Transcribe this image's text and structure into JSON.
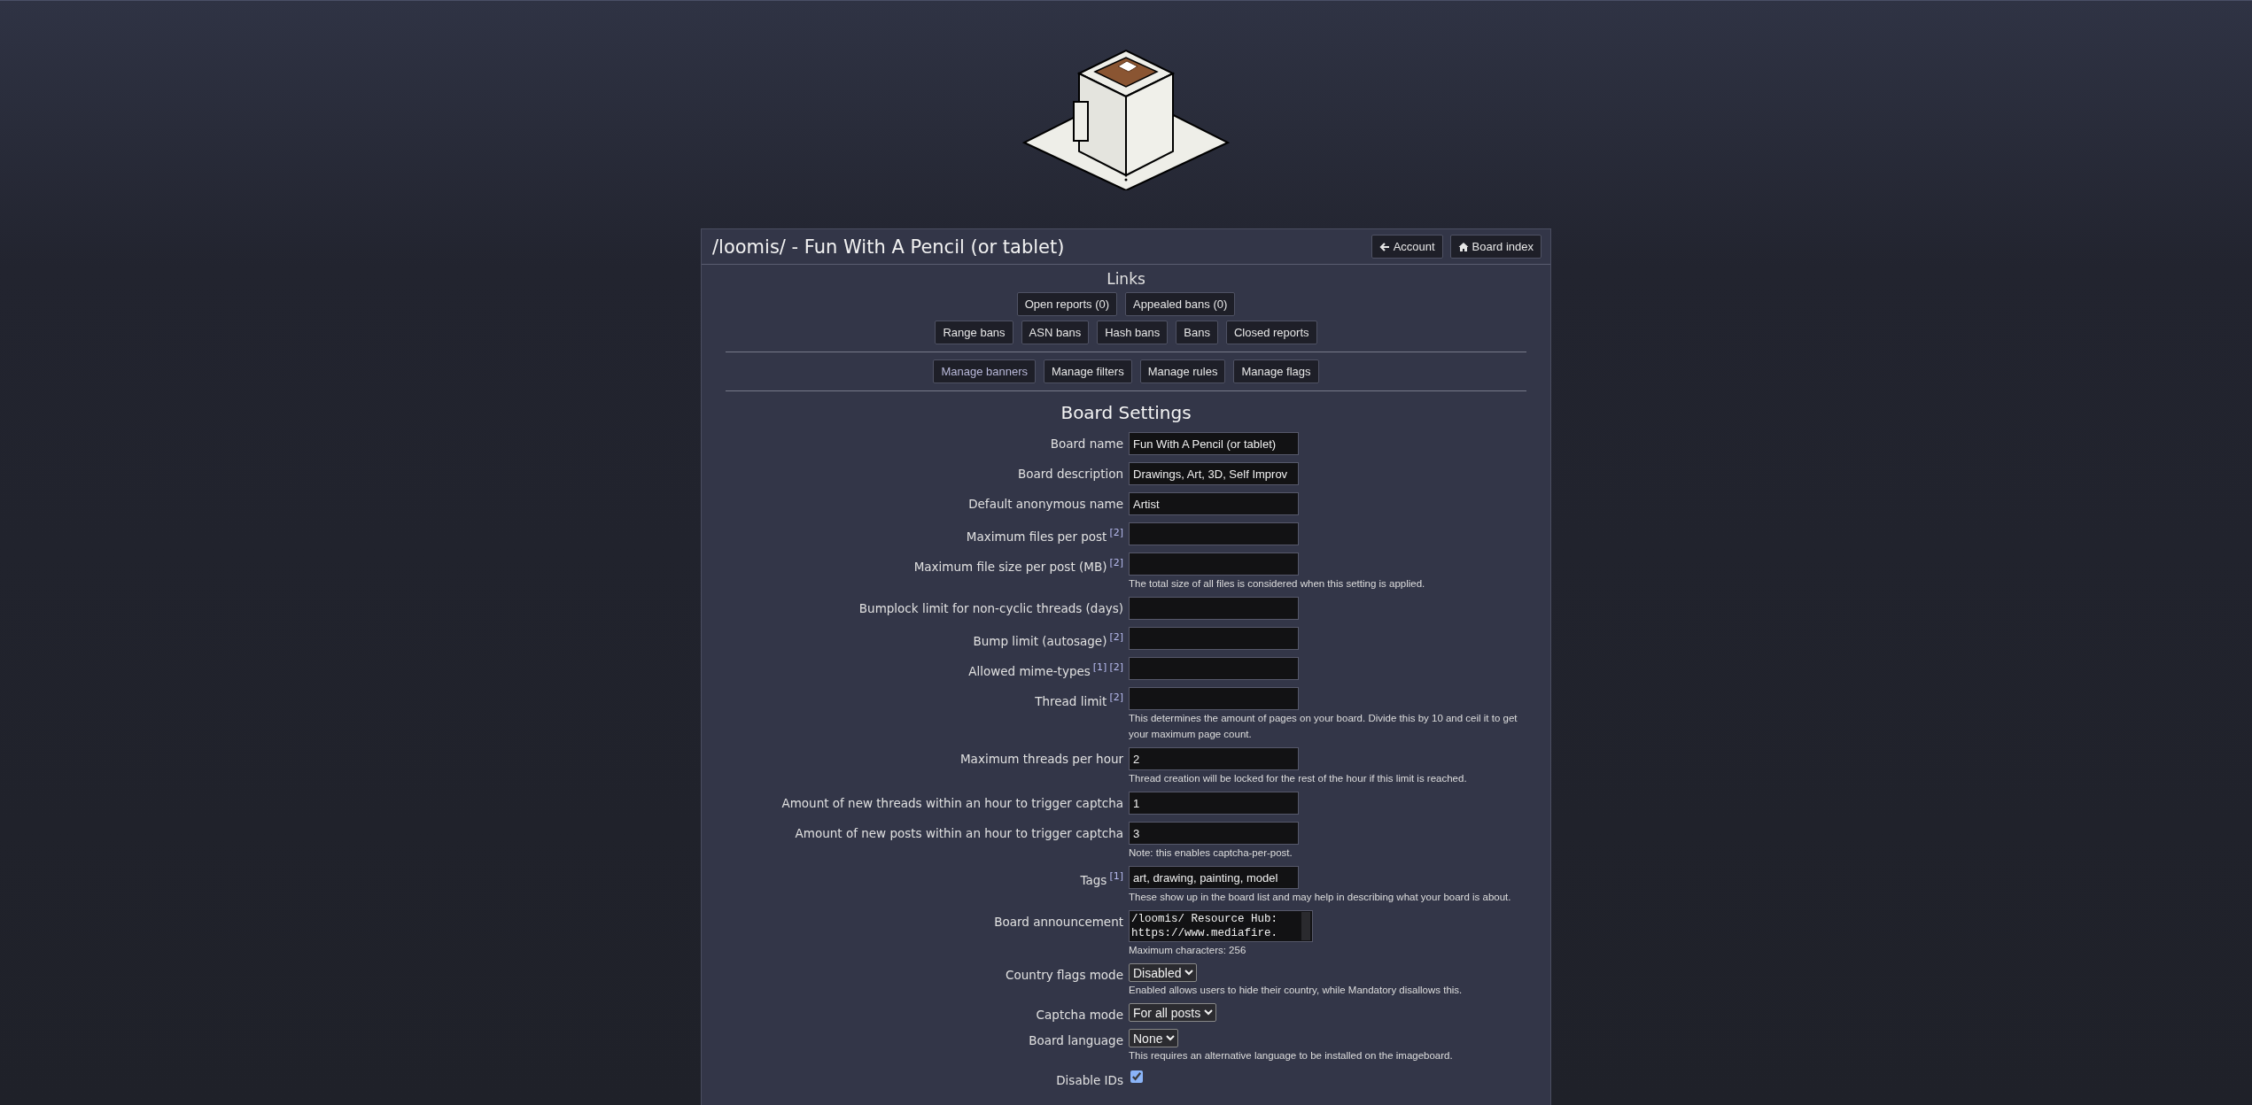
{
  "header": {
    "title": "/loomis/ - Fun With A Pencil (or tablet)",
    "buttons": [
      {
        "label": "Account",
        "kind": "back"
      },
      {
        "label": "Board index",
        "kind": "home"
      }
    ]
  },
  "links": {
    "heading": "Links",
    "rows": [
      {
        "buttons": [
          {
            "label": "Open reports (0)",
            "visited": false
          },
          {
            "label": "Appealed bans (0)",
            "visited": false
          }
        ]
      },
      {
        "buttons": [
          {
            "label": "Range bans",
            "visited": false
          },
          {
            "label": "ASN bans",
            "visited": false
          },
          {
            "label": "Hash bans",
            "visited": false
          },
          {
            "label": "Bans",
            "visited": false
          },
          {
            "label": "Closed reports",
            "visited": false
          }
        ]
      },
      {
        "buttons": [
          {
            "label": "Manage banners",
            "visited": true
          },
          {
            "label": "Manage filters",
            "visited": false
          },
          {
            "label": "Manage rules",
            "visited": false
          },
          {
            "label": "Manage flags",
            "visited": false
          }
        ]
      }
    ]
  },
  "settings": {
    "heading": "Board Settings",
    "fields": [
      {
        "label": "Board name",
        "kind": "text",
        "value": "Fun With A Pencil (or tablet)"
      },
      {
        "label": "Board description",
        "kind": "text",
        "value": "Drawings, Art, 3D, Self Improv"
      },
      {
        "label": "Default anonymous name",
        "kind": "text",
        "value": "Artist"
      },
      {
        "label": "Maximum files per post",
        "notes": [
          "[2]"
        ],
        "kind": "text"
      },
      {
        "label": "Maximum file size per post (MB)",
        "notes": [
          "[2]"
        ],
        "kind": "text",
        "hint": "The total size of all files is considered when this setting is applied."
      },
      {
        "label": "Bumplock limit for non-cyclic threads (days)",
        "kind": "text"
      },
      {
        "label": "Bump limit (autosage)",
        "notes": [
          "[2]"
        ],
        "kind": "text"
      },
      {
        "label": "Allowed mime-types",
        "notes": [
          "[1]",
          "[2]"
        ],
        "kind": "text"
      },
      {
        "label": "Thread limit",
        "notes": [
          "[2]"
        ],
        "kind": "text",
        "hint": "This determines the amount of pages on your board. Divide this by 10 and ceil it to get your maximum page count."
      },
      {
        "label": "Maximum threads per hour",
        "kind": "text",
        "value": "2",
        "hint": "Thread creation will be locked for the rest of the hour if this limit is reached."
      },
      {
        "label": "Amount of new threads within an hour to trigger captcha",
        "kind": "text",
        "value": "1"
      },
      {
        "label": "Amount of new posts within an hour to trigger captcha",
        "kind": "text",
        "value": "3",
        "hint": "Note: this enables captcha-per-post."
      },
      {
        "label": "Tags",
        "notes": [
          "[1]"
        ],
        "kind": "text",
        "value": "art, drawing, painting, model",
        "hint": "These show up in the board list and may help in describing what your board is about."
      },
      {
        "label": "Board announcement",
        "kind": "textarea",
        "value": "/loomis/ Resource Hub:\nhttps://www.mediafire.",
        "hint": "Maximum characters: 256"
      },
      {
        "label": "Country flags mode",
        "kind": "select",
        "value": "Disabled",
        "hint": "Enabled allows users to hide their country, while Mandatory disallows this."
      },
      {
        "label": "Captcha mode",
        "kind": "select",
        "value": "For all posts"
      },
      {
        "label": "Board language",
        "kind": "select",
        "value": "None",
        "hint": "This requires an alternative language to be installed on the imageboard."
      },
      {
        "label": "Disable IDs",
        "kind": "checkbox",
        "checked": true
      }
    ]
  }
}
